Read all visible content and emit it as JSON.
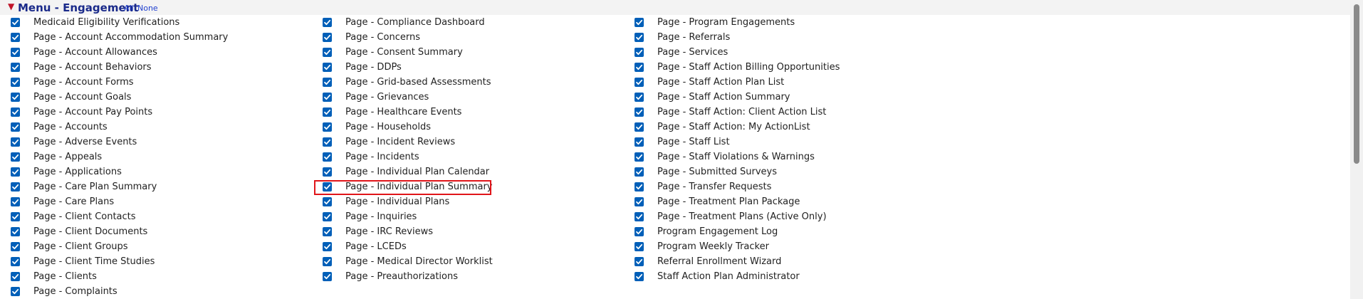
{
  "section": {
    "caret_icon": "chevron-down-icon",
    "title": "Menu - Engagement",
    "all_link": "All",
    "none_link": "None"
  },
  "columns": [
    {
      "items": [
        {
          "label": "Medicaid Eligibility Verifications",
          "checked": true
        },
        {
          "label": "Page - Account Accommodation Summary",
          "checked": true
        },
        {
          "label": "Page - Account Allowances",
          "checked": true
        },
        {
          "label": "Page - Account Behaviors",
          "checked": true
        },
        {
          "label": "Page - Account Forms",
          "checked": true
        },
        {
          "label": "Page - Account Goals",
          "checked": true
        },
        {
          "label": "Page - Account Pay Points",
          "checked": true
        },
        {
          "label": "Page - Accounts",
          "checked": true
        },
        {
          "label": "Page - Adverse Events",
          "checked": true
        },
        {
          "label": "Page - Appeals",
          "checked": true
        },
        {
          "label": "Page - Applications",
          "checked": true
        },
        {
          "label": "Page - Care Plan Summary",
          "checked": true
        },
        {
          "label": "Page - Care Plans",
          "checked": true
        },
        {
          "label": "Page - Client Contacts",
          "checked": true
        },
        {
          "label": "Page - Client Documents",
          "checked": true
        },
        {
          "label": "Page - Client Groups",
          "checked": true
        },
        {
          "label": "Page - Client Time Studies",
          "checked": true
        },
        {
          "label": "Page - Clients",
          "checked": true
        },
        {
          "label": "Page - Complaints",
          "checked": true
        }
      ]
    },
    {
      "items": [
        {
          "label": "Page - Compliance Dashboard",
          "checked": true
        },
        {
          "label": "Page - Concerns",
          "checked": true
        },
        {
          "label": "Page - Consent Summary",
          "checked": true
        },
        {
          "label": "Page - DDPs",
          "checked": true
        },
        {
          "label": "Page - Grid-based Assessments",
          "checked": true
        },
        {
          "label": "Page - Grievances",
          "checked": true
        },
        {
          "label": "Page - Healthcare Events",
          "checked": true
        },
        {
          "label": "Page - Households",
          "checked": true
        },
        {
          "label": "Page - Incident Reviews",
          "checked": true
        },
        {
          "label": "Page - Incidents",
          "checked": true
        },
        {
          "label": "Page - Individual Plan Calendar",
          "checked": true
        },
        {
          "label": "Page - Individual Plan Summary",
          "checked": true,
          "highlighted": true
        },
        {
          "label": "Page - Individual Plans",
          "checked": true
        },
        {
          "label": "Page - Inquiries",
          "checked": true
        },
        {
          "label": "Page - IRC Reviews",
          "checked": true
        },
        {
          "label": "Page - LCEDs",
          "checked": true
        },
        {
          "label": "Page - Medical Director Worklist",
          "checked": true
        },
        {
          "label": "Page - Preauthorizations",
          "checked": true
        }
      ]
    },
    {
      "items": [
        {
          "label": "Page - Program Engagements",
          "checked": true
        },
        {
          "label": "Page - Referrals",
          "checked": true
        },
        {
          "label": "Page - Services",
          "checked": true
        },
        {
          "label": "Page - Staff Action Billing Opportunities",
          "checked": true
        },
        {
          "label": "Page - Staff Action Plan List",
          "checked": true
        },
        {
          "label": "Page - Staff Action Summary",
          "checked": true
        },
        {
          "label": "Page - Staff Action: Client Action List",
          "checked": true
        },
        {
          "label": "Page - Staff Action: My ActionList",
          "checked": true
        },
        {
          "label": "Page - Staff List",
          "checked": true
        },
        {
          "label": "Page - Staff Violations & Warnings",
          "checked": true
        },
        {
          "label": "Page - Submitted Surveys",
          "checked": true
        },
        {
          "label": "Page - Transfer Requests",
          "checked": true
        },
        {
          "label": "Page - Treatment Plan Package",
          "checked": true
        },
        {
          "label": "Page - Treatment Plans (Active Only)",
          "checked": true
        },
        {
          "label": "Program Engagement Log",
          "checked": true
        },
        {
          "label": "Program Weekly Tracker",
          "checked": true
        },
        {
          "label": "Referral Enrollment Wizard",
          "checked": true
        },
        {
          "label": "Staff Action Plan Administrator",
          "checked": true
        }
      ]
    }
  ],
  "colors": {
    "checkbox": "#005fb8",
    "title": "#1a2a8a",
    "highlight": "#e0151a"
  }
}
